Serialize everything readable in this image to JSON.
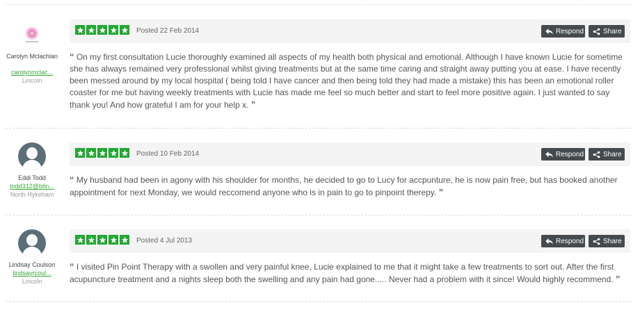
{
  "actions": {
    "respond_label": "Respond",
    "share_label": "Share"
  },
  "reviews": [
    {
      "name": "Carolyn Mclachlan",
      "email": "carolynmclac...",
      "location": "Lincoln",
      "avatar": "logo",
      "rating": 5,
      "date": "Posted 22 Feb 2014",
      "text": "On my first consultation Lucie thoroughly examined all aspects of my health both physical and emotional. Although I have known Lucie for sometime she has always remained very professional whilst giving treatments but at the same time caring and straight away putting you at ease. I have recently been messed around by my local hospital ( being told I have cancer and then being told they had made a mistake) this has been an emotional roller coaster for me but having weekly treatments with Lucie has made me feel so much better and start to feel more positive again. I just wanted to say thank you! And how grateful I am for your help x."
    },
    {
      "name": "Eddi Todd",
      "email": "todd312@btin...",
      "location": "North Hykeham",
      "avatar": "default-user-icon",
      "rating": 5,
      "date": "Posted 10 Feb 2014",
      "text": "My husband had been in agony with his shoulder for months, he decided to go to Lucy for accpunture, he is now pain free, but has booked another appointment for next Monday, we would reccomend anyone who is in pain to go to pinpoint therepy."
    },
    {
      "name": "Lindsay Coulson",
      "email": "lindsayrcoul...",
      "location": "Lincoln",
      "avatar": "default-user-icon",
      "rating": 5,
      "date": "Posted 4 Jul 2013",
      "text": "I visited Pin Point Therapy with a swollen and very painful knee, Lucie explained to me that it might take a few treatments to sort out. After the first acupuncture treatment and a nights sleep both the swelling and any pain had gone..... Never had a problem with it since! Would highly recommend."
    }
  ]
}
